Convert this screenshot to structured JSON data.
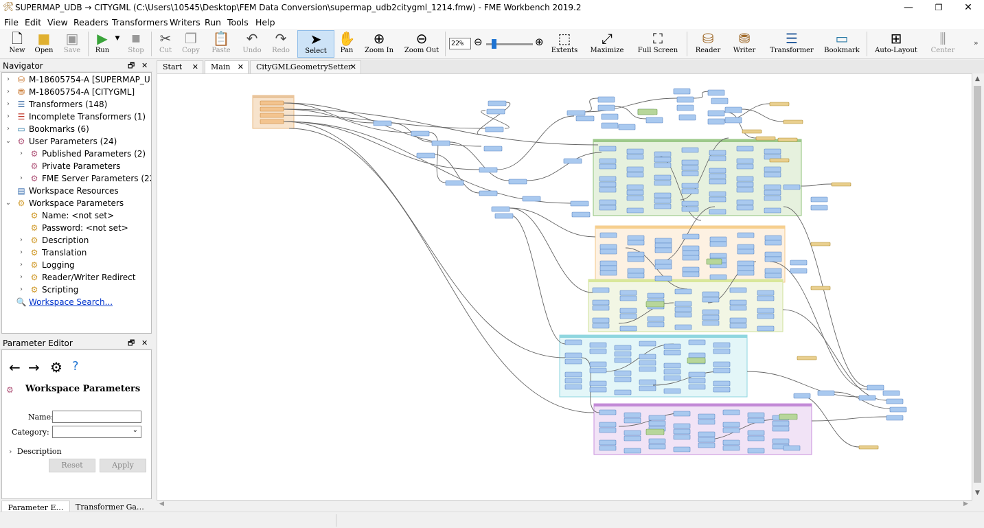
{
  "window": {
    "title": "SUPERMAP_UDB → CITYGML (C:\\Users\\10545\\Desktop\\FEM Data Conversion\\supermap_udb2citygml_1214.fmw) - FME Workbench 2019.2",
    "minimize": "—",
    "maximize": "❐",
    "close": "✕"
  },
  "menu": [
    "File",
    "Edit",
    "View",
    "Readers",
    "Transformers",
    "Writers",
    "Run",
    "Tools",
    "Help"
  ],
  "toolbar": {
    "new": "New",
    "open": "Open",
    "save": "Save",
    "run": "Run",
    "stop": "Stop",
    "cut": "Cut",
    "copy": "Copy",
    "paste": "Paste",
    "undo": "Undo",
    "redo": "Redo",
    "select": "Select",
    "pan": "Pan",
    "zoom_in": "Zoom In",
    "zoom_out": "Zoom Out",
    "zoom_level": "22%",
    "extents": "Extents",
    "maximize": "Maximize",
    "full_screen": "Full Screen",
    "reader": "Reader",
    "writer": "Writer",
    "transformer": "Transformer",
    "bookmark": "Bookmark",
    "auto_layout": "Auto-Layout",
    "center": "Center",
    "more": "»"
  },
  "navigator": {
    "title": "Navigator",
    "pin": "🗕",
    "close": "✕",
    "items": [
      {
        "label": "M-18605754-A [SUPERMAP_U...",
        "icon": "reader-icon",
        "depth": 0,
        "arrow": "›"
      },
      {
        "label": "M-18605754-A [CITYGML]",
        "icon": "writer-icon",
        "depth": 0,
        "arrow": "›"
      },
      {
        "label": "Transformers (148)",
        "icon": "transformer-icon",
        "depth": 0,
        "arrow": "›"
      },
      {
        "label": "Incomplete Transformers (1)",
        "icon": "incomplete-transformer-icon",
        "depth": 0,
        "arrow": "›"
      },
      {
        "label": "Bookmarks (6)",
        "icon": "bookmark-icon",
        "depth": 0,
        "arrow": "›"
      },
      {
        "label": "User Parameters (24)",
        "icon": "user-parameters-icon",
        "depth": 0,
        "arrow": "⌄"
      },
      {
        "label": "Published Parameters (2)",
        "icon": "published-parameters-icon",
        "depth": 1,
        "arrow": "›"
      },
      {
        "label": "Private Parameters",
        "icon": "private-parameters-icon",
        "depth": 1,
        "arrow": ""
      },
      {
        "label": "FME Server Parameters (22)",
        "icon": "server-parameters-icon",
        "depth": 1,
        "arrow": "›"
      },
      {
        "label": "Workspace Resources",
        "icon": "resources-icon",
        "depth": 0,
        "arrow": ""
      },
      {
        "label": "Workspace Parameters",
        "icon": "workspace-parameters-icon",
        "depth": 0,
        "arrow": "⌄"
      },
      {
        "label": "Name: <not set>",
        "icon": "parameter-icon",
        "depth": 1,
        "arrow": ""
      },
      {
        "label": "Password: <not set>",
        "icon": "parameter-icon",
        "depth": 1,
        "arrow": ""
      },
      {
        "label": "Description",
        "icon": "parameter-icon",
        "depth": 1,
        "arrow": "›"
      },
      {
        "label": "Translation",
        "icon": "parameter-icon",
        "depth": 1,
        "arrow": "›"
      },
      {
        "label": "Logging",
        "icon": "parameter-icon",
        "depth": 1,
        "arrow": "›"
      },
      {
        "label": "Reader/Writer Redirect",
        "icon": "parameter-icon",
        "depth": 1,
        "arrow": "›"
      },
      {
        "label": "Scripting",
        "icon": "parameter-icon",
        "depth": 1,
        "arrow": "›"
      },
      {
        "label": "Workspace Search...",
        "icon": "search-icon",
        "depth": 0,
        "arrow": "",
        "link": true
      }
    ]
  },
  "parameter_editor": {
    "title": "Parameter Editor",
    "heading": "Workspace Parameters",
    "name_label": "Name:",
    "name_value": "",
    "category_label": "Category:",
    "category_value": "",
    "description_label": "Description",
    "reset": "Reset",
    "apply": "Apply"
  },
  "bottom_tabs": [
    "Parameter E…",
    "Transformer Ga…"
  ],
  "doc_tabs": [
    {
      "label": "Start",
      "close": "✕"
    },
    {
      "label": "Main",
      "close": "✕",
      "active": true
    },
    {
      "label": "CityGMLGeometrySetter",
      "close": "✕"
    }
  ],
  "colors": {
    "reader_bookmark": "#f7e3cc",
    "green_bookmark": "#e6f1de",
    "orange_bookmark": "#fdf1e2",
    "yellow_bookmark": "#f2f6e4",
    "cyan_bookmark": "#e3f6f8",
    "purple_bookmark": "#f1e3f6",
    "transformer": "#a9c9ef",
    "writer": "#e9cf8e"
  }
}
